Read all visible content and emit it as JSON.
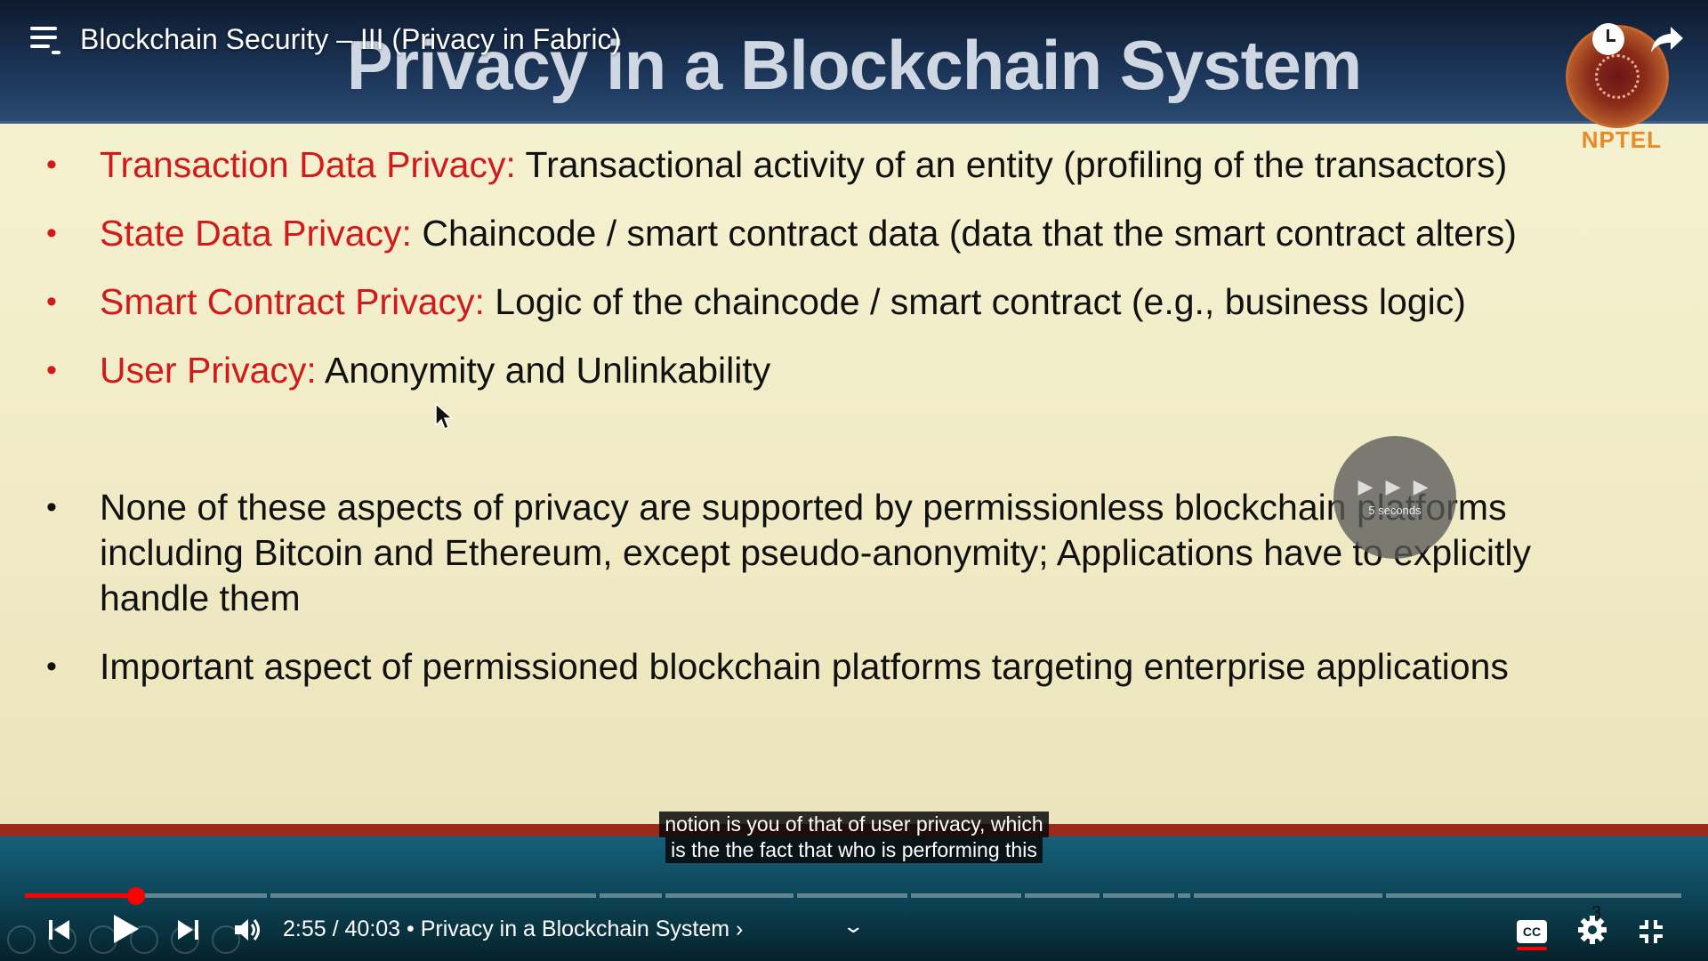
{
  "slide": {
    "title": "Privacy in a Blockchain System",
    "logo_text": "NPTEL",
    "bullets": [
      {
        "term": "Transaction Data Privacy:",
        "text": " Transactional activity of an entity (profiling of the transactors)"
      },
      {
        "term": "State Data Privacy:",
        "text": " Chaincode / smart contract data (data that the smart contract alters)"
      },
      {
        "term": "Smart Contract Privacy:",
        "text": " Logic of the chaincode / smart contract (e.g., business logic)"
      },
      {
        "term": "User Privacy:",
        "text": " Anonymity and Unlinkability"
      }
    ],
    "notes": [
      "None of these aspects of privacy are supported by permissionless blockchain platforms including Bitcoin and Ethereum, except pseudo-anonymity; Applications have to explicitly handle them",
      "Important aspect of permissioned blockchain platforms targeting enterprise applications"
    ],
    "bullet_glyph": "•"
  },
  "player": {
    "video_title": "Blockchain Security – III (Privacy in Fabric)",
    "skip_label": "5 seconds",
    "skip_arrows": "▶ ▶ ▶",
    "captions": [
      "notion is you of that of user privacy, which",
      "is the the fact that who is performing this"
    ],
    "current_time": "2:55",
    "duration": "40:03",
    "time_separator": " / ",
    "chapter_separator": " • ",
    "chapter": "Privacy in a Blockchain System",
    "chapter_arrow": " ›",
    "chevron": "⌄",
    "cc_label": "CC",
    "badge": "3",
    "progress_fraction": 0.067,
    "icons": {
      "menu": "playlist-icon",
      "watch_later": "clock-icon",
      "share": "share-icon",
      "prev": "skip-previous-icon",
      "play": "play-icon",
      "next": "skip-next-icon",
      "volume": "volume-icon",
      "settings": "gear-icon",
      "exit_fullscreen": "exit-fullscreen-icon"
    },
    "accent_color": "#ff0000"
  }
}
